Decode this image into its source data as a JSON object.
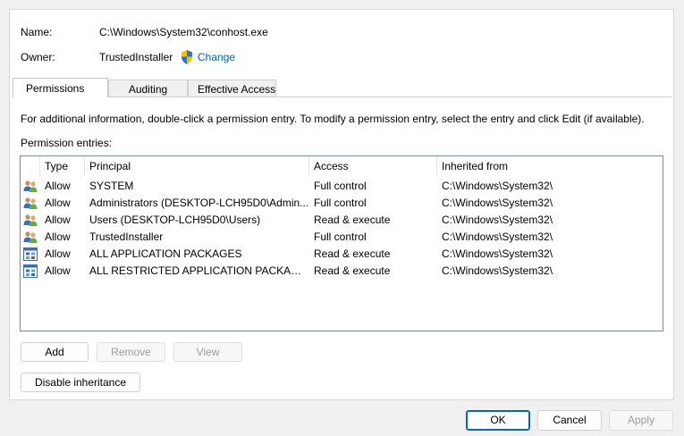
{
  "header": {
    "name_label": "Name:",
    "name_value": "C:\\Windows\\System32\\conhost.exe",
    "owner_label": "Owner:",
    "owner_value": "TrustedInstaller",
    "change_link": "Change"
  },
  "tabs": [
    {
      "label": "Permissions",
      "active": true
    },
    {
      "label": "Auditing",
      "active": false
    },
    {
      "label": "Effective Access",
      "active": false
    }
  ],
  "info_text": "For additional information, double-click a permission entry. To modify a permission entry, select the entry and click Edit (if available).",
  "entries_label": "Permission entries:",
  "columns": {
    "type": "Type",
    "principal": "Principal",
    "access": "Access",
    "inherited": "Inherited from"
  },
  "rows": [
    {
      "icon": "users-icon",
      "type": "Allow",
      "principal": "SYSTEM",
      "access": "Full control",
      "inherited": "C:\\Windows\\System32\\"
    },
    {
      "icon": "users-icon",
      "type": "Allow",
      "principal": "Administrators (DESKTOP-LCH95D0\\Admin...",
      "access": "Full control",
      "inherited": "C:\\Windows\\System32\\"
    },
    {
      "icon": "users-icon",
      "type": "Allow",
      "principal": "Users (DESKTOP-LCH95D0\\Users)",
      "access": "Read & execute",
      "inherited": "C:\\Windows\\System32\\"
    },
    {
      "icon": "users-icon",
      "type": "Allow",
      "principal": "TrustedInstaller",
      "access": "Full control",
      "inherited": "C:\\Windows\\System32\\"
    },
    {
      "icon": "app-package-icon",
      "type": "Allow",
      "principal": "ALL APPLICATION PACKAGES",
      "access": "Read & execute",
      "inherited": "C:\\Windows\\System32\\"
    },
    {
      "icon": "app-package-icon",
      "type": "Allow",
      "principal": "ALL RESTRICTED APPLICATION PACKAGES",
      "access": "Read & execute",
      "inherited": "C:\\Windows\\System32\\"
    }
  ],
  "buttons": {
    "add": "Add",
    "remove": "Remove",
    "view": "View",
    "disable_inheritance": "Disable inheritance",
    "ok": "OK",
    "cancel": "Cancel",
    "apply": "Apply"
  },
  "colors": {
    "link": "#0063b1",
    "accent": "#0067c0"
  }
}
